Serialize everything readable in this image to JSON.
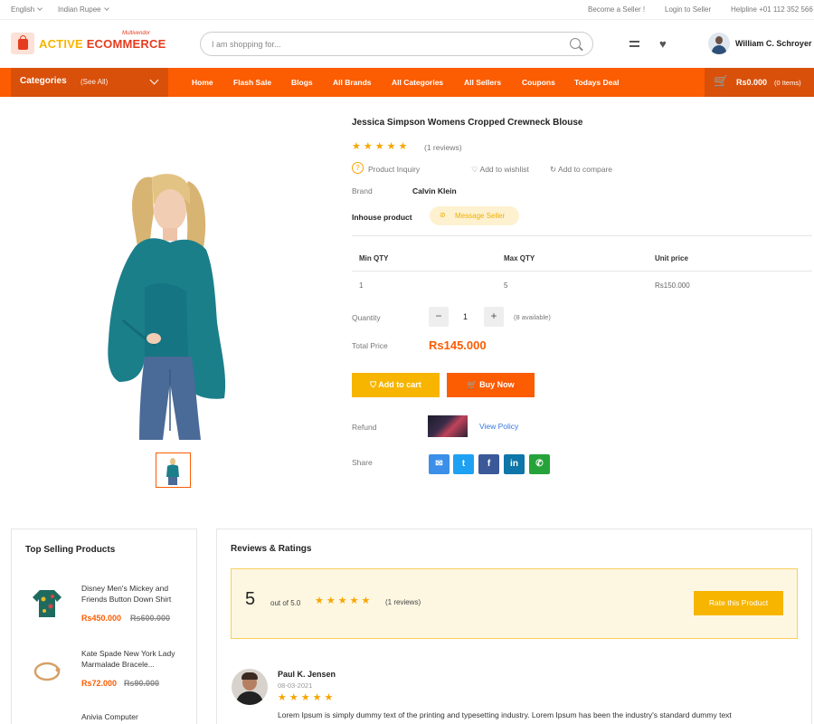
{
  "topbar": {
    "language": "English",
    "currency": "Indian Rupee",
    "become_seller": "Become a Seller !",
    "login_seller": "Login to Seller",
    "helpline": "Helpline +01 112 352 566"
  },
  "header": {
    "logo_word1": "ACTIVE",
    "logo_word2": "ECOMMERCE",
    "logo_sub": "Multivendor",
    "search_placeholder": "I am shopping for...",
    "username": "William C. Schroyer"
  },
  "nav": {
    "categories_label": "Categories",
    "see_all": "(See All)",
    "links": [
      "Home",
      "Flash Sale",
      "Blogs",
      "All Brands",
      "All Categories",
      "All Sellers",
      "Coupons",
      "Todays Deal"
    ],
    "cart_amount": "Rs0.000",
    "cart_items": "(0 Items)"
  },
  "product": {
    "title": "Jessica Simpson Womens Cropped Crewneck Blouse",
    "rating": 5,
    "reviews_count": "(1 reviews)",
    "inquiry": "Product Inquiry",
    "wishlist": "Add to wishlist",
    "compare": "Add to compare",
    "brand_label": "Brand",
    "brand_value": "Calvin Klein",
    "inhouse": "Inhouse product",
    "message_seller": "Message Seller",
    "table_headers": [
      "Min QTY",
      "Max QTY",
      "Unit price"
    ],
    "table_row": [
      "1",
      "5",
      "Rs150.000"
    ],
    "quantity_label": "Quantity",
    "quantity_value": "1",
    "available": "(8 available)",
    "total_label": "Total Price",
    "total_value": "Rs145.000",
    "add_to_cart": "Add to cart",
    "buy_now": "Buy Now",
    "refund_label": "Refund",
    "view_policy": "View Policy",
    "share_label": "Share"
  },
  "top_selling": {
    "title": "Top Selling Products",
    "items": [
      {
        "name": "Disney Men's Mickey and Friends Button Down Shirt",
        "price": "Rs450.000",
        "old_price": "Rs600.000"
      },
      {
        "name": "Kate Spade New York Lady Marmalade Bracele...",
        "price": "Rs72.000",
        "old_price": "Rs90.000"
      },
      {
        "name": "Anivia Computer",
        "price": "",
        "old_price": ""
      }
    ]
  },
  "reviews": {
    "title": "Reviews & Ratings",
    "score": "5",
    "out_of": "out of 5.0",
    "count": "(1 reviews)",
    "rate_button": "Rate this Product",
    "review": {
      "author": "Paul K. Jensen",
      "date": "08-03-2021",
      "text": "Lorem Ipsum is simply dummy text of the printing and typesetting industry. Lorem Ipsum has been the industry's standard dummy text"
    }
  },
  "colors": {
    "primary": "#fc5c02",
    "accent": "#f7b500"
  }
}
